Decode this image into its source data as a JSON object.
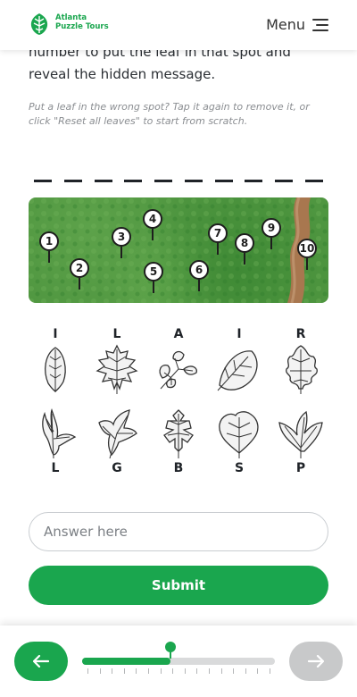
{
  "header": {
    "logo_line1": "Atlanta",
    "logo_line2": "Puzzle Tours",
    "menu_label": "Menu",
    "brand_color": "#1aa64e"
  },
  "intro": {
    "text": "number to put the leaf in that spot and reveal the hidden message."
  },
  "hint": {
    "text": "Put a leaf in the wrong spot? Tap it again to remove it, or click \"Reset all leaves\" to start from scratch."
  },
  "answer_slots": 10,
  "map": {
    "pins": [
      "1",
      "2",
      "3",
      "4",
      "5",
      "6",
      "7",
      "8",
      "9",
      "10"
    ]
  },
  "leaves_top": [
    {
      "letter": "I",
      "icon": "oval-serrated-leaf-icon"
    },
    {
      "letter": "L",
      "icon": "lobed-oak-leaf-icon"
    },
    {
      "letter": "A",
      "icon": "clustered-leaf-icon"
    },
    {
      "letter": "I",
      "icon": "broad-round-leaf-icon"
    },
    {
      "letter": "R",
      "icon": "curly-lobed-leaf-icon"
    }
  ],
  "leaves_bottom": [
    {
      "letter": "L",
      "icon": "narrow-forked-leaf-icon"
    },
    {
      "letter": "G",
      "icon": "three-lobed-leaf-icon"
    },
    {
      "letter": "B",
      "icon": "pointed-oak-leaf-icon"
    },
    {
      "letter": "S",
      "icon": "heart-leaf-icon"
    },
    {
      "letter": "P",
      "icon": "three-point-leaf-icon"
    }
  ],
  "answer": {
    "placeholder": "Answer here",
    "value": ""
  },
  "submit_label": "Submit",
  "progress": {
    "fraction": 0.46,
    "tick_count": 16
  },
  "nav": {
    "prev_icon": "arrow-left-icon",
    "next_icon": "arrow-right-icon"
  }
}
